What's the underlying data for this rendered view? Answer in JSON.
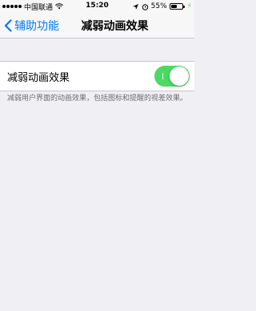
{
  "status_bar": {
    "carrier": "中国联通",
    "time": "15:20",
    "battery_percent": "55%",
    "battery_level": 0.55
  },
  "nav": {
    "back_label": "辅助功能",
    "title": "减弱动画效果"
  },
  "setting": {
    "label": "减弱动画效果",
    "toggle_on": true,
    "toggle_color": "#4cd964"
  },
  "footer": {
    "description": "减弱用户界面的动画效果，包括图标和提醒的视差效果。"
  },
  "colors": {
    "accent": "#007aff",
    "background": "#efeff4"
  }
}
